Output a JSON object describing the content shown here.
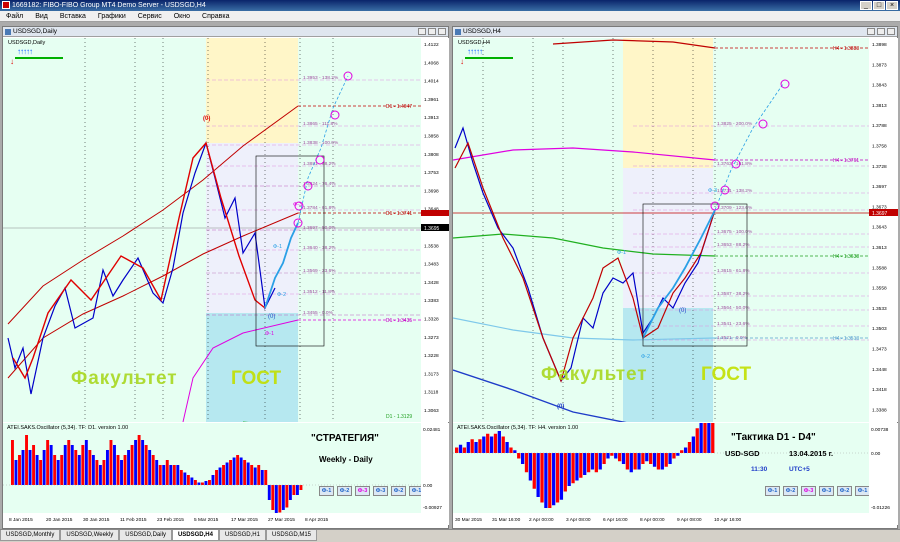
{
  "window": {
    "title": "1669182: FIBO-FIBO Group MT4 Demo Server - USDSGD,H4"
  },
  "menu": [
    "Файл",
    "Вид",
    "Вставка",
    "Графики",
    "Сервис",
    "Окно",
    "Справка"
  ],
  "left": {
    "title": "USDSGD,Daily",
    "symbol_label": "USDSGD,Daily",
    "watermark1": "Факультет",
    "watermark2": "ГОСТ",
    "osc_label": "ATEI.SAKS.Oscillator (5,34). TF: D1.  version 1.00",
    "strategy_title": "\"СТРАТЕГИЯ\"",
    "strategy_sub": "Weekly - Daily",
    "wave_labels": [
      "(0)",
      "(0)",
      "Ф-1",
      "Ф-2",
      "Ф-3"
    ],
    "price_axis": [
      "1.4122",
      "1.4068",
      "1.4014",
      "1.3961",
      "1.3913",
      "1.3858",
      "1.3808",
      "1.3753",
      "1.3698",
      "1.3648",
      "1.3593",
      "1.3538",
      "1.3483",
      "1.3428",
      "1.3383",
      "1.3328",
      "1.3273",
      "1.3228",
      "1.3173",
      "1.3118",
      "1.3063"
    ],
    "current_price": "1.3695",
    "osc_axis": [
      "0.02481",
      "0.00",
      "-0.00927"
    ],
    "dates": [
      "8 Jan 2015",
      "20 Jan 2015",
      "30 Jan 2015",
      "11 Feb 2015",
      "23 Feb 2015",
      "5 Mar 2015",
      "17 Mar 2015",
      "27 Mar 2015",
      "8 Apr 2015"
    ],
    "fib_levels": [
      "1.3953 - 138.2%",
      "1.3865 - 111.8%",
      "1.3838 - 100.0%",
      "1.3881 - 88.2%",
      "1.3824 - 76.4%",
      "1.3784 - 61.8%",
      "1.3697 - 50.0%",
      "1.3640 - 38.2%",
      "1.3569 - 23.6%",
      "1.3512 - 11.8%",
      "1.3455 - 0.0%"
    ],
    "ma_labels": [
      "D1 - 1.4047",
      "D1 - 1.3741",
      "D1 - 1.3435",
      "D1 - 1.3129"
    ],
    "buttons": [
      "Ф-1",
      "Ф-2",
      "Ф-3",
      "Ф-3",
      "Ф-2",
      "Ф-1"
    ]
  },
  "right": {
    "title": "USDSGD,H4",
    "symbol_label": "USDSGD,H4",
    "watermark1": "Факультет",
    "watermark2": "ГОСТ",
    "osc_label": "ATEI.SAKS.Oscillator (5,34). TF: H4.  version 1.00",
    "tactic_title": "\"Тактика   D1 - D4\"",
    "tactic_pair": "USD-SGD",
    "tactic_date": "13.04.2015 г.",
    "tactic_time": "11:30",
    "tactic_tz": "UTC+5",
    "wave_labels": [
      "(0)",
      "(0)",
      "Ф-1",
      "Ф-2",
      "Ф-3"
    ],
    "price_axis": [
      "1.3898",
      "1.3873",
      "1.3843",
      "1.3813",
      "1.3788",
      "1.3758",
      "1.3728",
      "1.3697",
      "1.3673",
      "1.3643",
      "1.3613",
      "1.3588",
      "1.3558",
      "1.3533",
      "1.3503",
      "1.3473",
      "1.3448",
      "1.3418",
      "1.3388"
    ],
    "current_price": "1.3697",
    "osc_axis": [
      "0.00738",
      "0.00",
      "-0.01226"
    ],
    "dates": [
      "30 Mar 2015",
      "31 Mar 16:00",
      "2 Apr 00:00",
      "3 Apr 08:00",
      "6 Apr 16:00",
      "8 Apr 00:00",
      "9 Apr 08:00",
      "10 Apr 16:00"
    ],
    "fib_levels": [
      "1.3825 - 200.0%",
      "1.3763 - 161.8%",
      "1.3731 - 138.2%",
      "1.3709 - 123.6%",
      "1.3675 - 100.0%",
      "1.3653 - 88.2%",
      "1.3615 - 61.8%",
      "1.3587 - 38.2%",
      "1.3564 - 50.0%",
      "1.3541 - 23.6%",
      "1.3521 - 0.0%"
    ],
    "ma_labels": [
      "H4 - 1.3883",
      "H4 - 1.3761",
      "H4 - 1.3638",
      "H4 - 1.3513",
      "H4 - 1.3393"
    ],
    "buttons": [
      "Ф-1",
      "Ф-2",
      "Ф-3",
      "Ф-3",
      "Ф-2",
      "Ф-1"
    ]
  },
  "tabs": [
    "USDSGD,Monthly",
    "USDSGD,Weekly",
    "USDSGD,Daily",
    "USDSGD,H4",
    "USDSGD,H1",
    "USDSGD,M15"
  ],
  "active_tab": 3,
  "colors": {
    "bg": "#e6fff2",
    "zone_yellow": "#fff6c8",
    "zone_blue": "#b6e8f0",
    "osc_red": "#ff0000",
    "osc_blue": "#0000ff",
    "ma_red": "#c00000",
    "ma_magenta": "#e000e0",
    "ma_green": "#20b020"
  },
  "osc_left": [
    0.9,
    0.5,
    0.6,
    0.7,
    1.0,
    0.7,
    0.8,
    0.6,
    0.5,
    0.7,
    0.9,
    0.8,
    0.6,
    0.5,
    0.6,
    0.8,
    0.9,
    0.8,
    0.7,
    0.6,
    0.8,
    0.9,
    0.7,
    0.6,
    0.5,
    0.4,
    0.5,
    0.7,
    0.9,
    0.8,
    0.6,
    0.5,
    0.6,
    0.7,
    0.8,
    0.9,
    1.0,
    0.9,
    0.8,
    0.7,
    0.6,
    0.5,
    0.4,
    0.4,
    0.5,
    0.4,
    0.4,
    0.4,
    0.3,
    0.25,
    0.2,
    0.15,
    0.1,
    0.05,
    0.05,
    0.08,
    0.1,
    0.2,
    0.3,
    0.35,
    0.4,
    0.45,
    0.5,
    0.55,
    0.6,
    0.55,
    0.5,
    0.45,
    0.4,
    0.35,
    0.4,
    0.3,
    0.3,
    -0.3,
    -0.5,
    -0.6,
    -0.55,
    -0.5,
    -0.45,
    -0.3,
    -0.2,
    -0.2,
    -0.1
  ],
  "osc_right": [
    0.1,
    0.15,
    0.1,
    0.2,
    0.25,
    0.2,
    0.25,
    0.3,
    0.35,
    0.3,
    0.35,
    0.4,
    0.3,
    0.2,
    0.1,
    0.05,
    -0.1,
    -0.2,
    -0.35,
    -0.5,
    -0.65,
    -0.8,
    -0.9,
    -1.0,
    -1.0,
    -0.95,
    -0.9,
    -0.85,
    -0.7,
    -0.6,
    -0.55,
    -0.5,
    -0.45,
    -0.4,
    -0.35,
    -0.3,
    -0.35,
    -0.3,
    -0.2,
    -0.1,
    -0.05,
    -0.1,
    -0.15,
    -0.2,
    -0.3,
    -0.35,
    -0.3,
    -0.3,
    -0.2,
    -0.15,
    -0.2,
    -0.25,
    -0.3,
    -0.3,
    -0.25,
    -0.2,
    -0.1,
    -0.05,
    0.05,
    0.1,
    0.2,
    0.3,
    0.45,
    0.6,
    0.8,
    0.9,
    1.0
  ]
}
